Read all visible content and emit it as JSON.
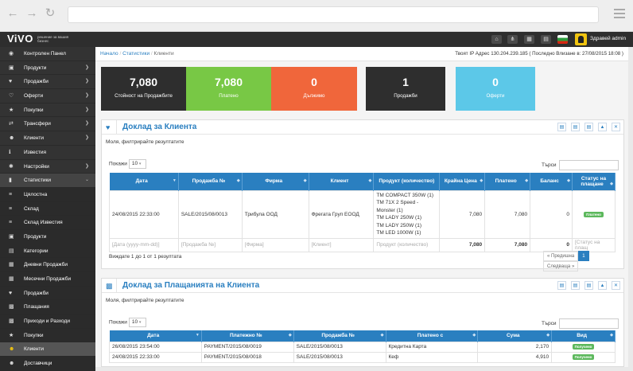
{
  "app": {
    "logo": "ViVO",
    "tagline": "решение за вашия бизнес",
    "user": "Здравей admin"
  },
  "toolbar_icons": [
    "home-icon",
    "share-icon",
    "calculator-icon",
    "calendar-icon",
    "flag-icon"
  ],
  "sidebar": {
    "items": [
      {
        "label": "Контролен Панел",
        "icon": "dashboard-icon",
        "chev": ""
      },
      {
        "label": "Продукти",
        "icon": "box-icon",
        "chev": "❯"
      },
      {
        "label": "Продажби",
        "icon": "heart-icon",
        "chev": "❯"
      },
      {
        "label": "Оферти",
        "icon": "heart-outline-icon",
        "chev": "❯"
      },
      {
        "label": "Покупки",
        "icon": "star-icon",
        "chev": "❯"
      },
      {
        "label": "Трансфери",
        "icon": "transfer-icon",
        "chev": "❯"
      },
      {
        "label": "Клиенти",
        "icon": "users-icon",
        "chev": "❯"
      },
      {
        "label": "Известия",
        "icon": "info-icon",
        "chev": ""
      },
      {
        "label": "Настройки",
        "icon": "cog-icon",
        "chev": "❯"
      },
      {
        "label": "Статистики",
        "icon": "chart-icon",
        "chev": "⌄"
      },
      {
        "label": "Цялостна",
        "icon": "bars-icon",
        "chev": ""
      },
      {
        "label": "Склад",
        "icon": "bars-icon",
        "chev": ""
      },
      {
        "label": "Склад Известия",
        "icon": "bars-icon",
        "chev": ""
      },
      {
        "label": "Продукти",
        "icon": "box-icon",
        "chev": ""
      },
      {
        "label": "Категории",
        "icon": "folder-icon",
        "chev": ""
      },
      {
        "label": "Дневни Продажби",
        "icon": "calendar-icon",
        "chev": ""
      },
      {
        "label": "Месечни Продажби",
        "icon": "calendar-icon",
        "chev": ""
      },
      {
        "label": "Продажби",
        "icon": "heart-icon",
        "chev": ""
      },
      {
        "label": "Плащания",
        "icon": "money-icon",
        "chev": ""
      },
      {
        "label": "Приходи и Разходи",
        "icon": "money-icon",
        "chev": ""
      },
      {
        "label": "Покупки",
        "icon": "star-icon",
        "chev": ""
      },
      {
        "label": "Клиенти",
        "icon": "users-icon",
        "chev": ""
      },
      {
        "label": "Доставчици",
        "icon": "users-icon",
        "chev": ""
      }
    ]
  },
  "breadcrumb": {
    "home": "Начало",
    "stats": "Статистики",
    "current": "Клиенти"
  },
  "ip_info": "Твоят IP Адрес 130.204.239.185 ( Последно Влизане в: 27/08/2015 18:08 )",
  "stats": [
    {
      "value": "7,080",
      "label": "Стойност на Продажбите",
      "color": "#2e2e2e"
    },
    {
      "value": "7,080",
      "label": "Платено",
      "color": "#78c845"
    },
    {
      "value": "0",
      "label": "Дължимо",
      "color": "#f0663b"
    },
    {
      "value": "1",
      "label": "Продажби",
      "color": "#2e2e2e"
    },
    {
      "value": "0",
      "label": "Оферти",
      "color": "#5cc8e8"
    }
  ],
  "report1": {
    "title": "Доклад за Клиента",
    "note": "Моля, филтрирайте резултатите",
    "show": "Покажи",
    "per_page": "10",
    "search": "Търси",
    "columns": [
      "Дата",
      "Продажба №",
      "Фирма",
      "Клиент",
      "Продукт (количество)",
      "Крайна Цена",
      "Платено",
      "Баланс",
      "Статус на плащане"
    ],
    "row": {
      "date": "24/08/2015 22:33:00",
      "sale": "SALE/2015/08/0013",
      "company": "Трибула ООД",
      "client": "Фрегата Груп ЕООД",
      "products": [
        "TM COMPACT 350W (1)",
        "TM 71X 2 Speed - Monster (1)",
        "TM LADY 250W (1)",
        "TM LADY 250W (1)",
        "TM LED 1000W (1)"
      ],
      "total": "7,080",
      "paid": "7,080",
      "balance": "0",
      "status": "Платено"
    },
    "filters": {
      "date": "[Дата (yyyy-mm-dd)]",
      "sale": "[Продажба №]",
      "company": "[Фирма]",
      "client": "[Клиент]",
      "product": "Продукт (количество)",
      "total": "7,080",
      "paid": "7,080",
      "balance": "0",
      "status": "[Статус на плащ"
    },
    "info": "Виждате 1 до 1 от 1 резултата",
    "prev": "« Предишна",
    "page": "1",
    "next": "Следваща »"
  },
  "report2": {
    "title": "Доклад за Плащанията на Клиента",
    "note": "Моля, филтрирайте резултатите",
    "show": "Покажи",
    "per_page": "10",
    "search": "Търси",
    "columns": [
      "Дата",
      "Платежно №",
      "Продажба №",
      "Платено с",
      "Сума",
      "Вид"
    ],
    "rows": [
      {
        "date": "26/08/2015 23:54:00",
        "payment": "PAYMENT/2015/08/0019",
        "sale": "SALE/2015/08/0013",
        "method": "Кредитна Карта",
        "amount": "2,170",
        "type": "Получено"
      },
      {
        "date": "24/08/2015 22:33:00",
        "payment": "PAYMENT/2015/08/0018",
        "sale": "SALE/2015/08/0013",
        "method": "Кеф",
        "amount": "4,910",
        "type": "Получено"
      }
    ]
  }
}
